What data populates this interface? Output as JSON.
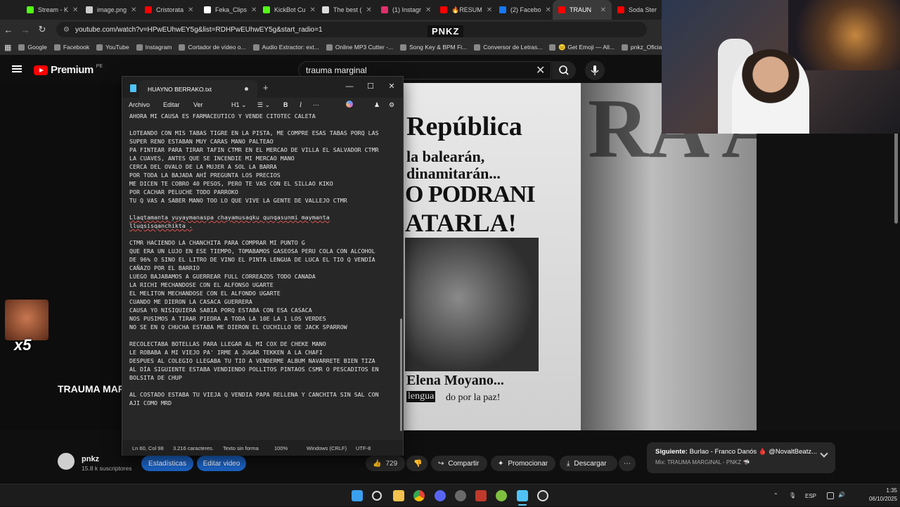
{
  "browser": {
    "tabs": [
      {
        "label": "Stream - K",
        "color": "#53fc18"
      },
      {
        "label": "image.png",
        "color": "#cccccc"
      },
      {
        "label": "Cristorata",
        "color": "#ff0000"
      },
      {
        "label": "Feka_Clips",
        "color": "#ffffff"
      },
      {
        "label": "KickBot Cu",
        "color": "#53fc18"
      },
      {
        "label": "The best (",
        "color": "#dddddd"
      },
      {
        "label": "(1) Instagr",
        "color": "#e1306c"
      },
      {
        "label": "🔥RESUM",
        "color": "#ff0000"
      },
      {
        "label": "(2) Facebo",
        "color": "#1877f2"
      },
      {
        "label": "TRAUN",
        "color": "#ff0000"
      },
      {
        "label": "Soda Ster",
        "color": "#ff0000"
      }
    ],
    "url": "youtube.com/watch?v=HPwEUhwEY5g&list=RDHPwEUhwEY5g&start_radio=1",
    "overlay_logo": "PNKZ",
    "bookmarks": [
      "Google",
      "Facebook",
      "YouTube",
      "Instagram",
      "Cortador de vídeo o...",
      "Audio Extractor: ext...",
      "Online MP3 Cutter -...",
      "Song Key & BPM Fi...",
      "Conversor de Letras...",
      "😐 Get Emoji — All...",
      "pnkz_Oficial"
    ]
  },
  "youtube": {
    "logo_word": "Premium",
    "logo_region": "PE",
    "search_value": "trauma marginal",
    "video_title": "TRAUMA MARG",
    "channel_name": "pnkz",
    "channel_subs": "15.8 k suscriptores",
    "buttons": {
      "stats": "Estadísticas",
      "edit": "Editar video",
      "likes": "729",
      "share": "Compartir",
      "promote": "Promocionar",
      "download": "Descargar"
    },
    "next": {
      "label": "Siguiente:",
      "title": "Burlao - Franco Danós 🩸 @NovaltBeatz...",
      "mix": "Mix: TRAUMA MARGINAL - PNKZ 🦈"
    },
    "newspaper": {
      "title": "República",
      "line1": "la balearán,",
      "line2": "dinamitarán...",
      "head1": "O PODRANI",
      "head2": "ATARLA!",
      "name": "Elena Moyano...",
      "sub": "lengua",
      "paz": "do por la paz!"
    },
    "blur_text": "RA A!",
    "emoji_count": "x5"
  },
  "notepad": {
    "filename": "HUAYNO BERRAKO.txt",
    "menus": {
      "archivo": "Archivo",
      "editar": "Editar",
      "ver": "Ver",
      "heading": "H1"
    },
    "lines": [
      "AHORA MI CAUSA ES FARMACEUTICO Y VENDE CITOTEC CALETA",
      "",
      "LOTEANDO CON MIS TABAS TIGRE EN LA PISTA, ME COMPRE ESAS TABAS PORQ LAS",
      "SUPER RENO ESTABAN MUY CARAS MANO PALTEAO",
      "PA FINTEAR PARA TIRAR TAFIN CTMR EN EL MERCAO DE VILLA EL SALVADOR CTMR",
      "LA CUAVES, ANTES QUE SE INCENDIE MI MERCAO MANO",
      "CERCA DEL OVALO DE LA MUJER A SOL LA BARRA",
      "POR TODA LA BAJADA AHÍ PREGUNTA LOS PRECIOS",
      "ME DICEN TE COBRO 40 PESOS, PERO TE VAS CON EL SILLAO KIKO",
      "POR CACHAR PELUCHE TODO PARROKO",
      "TU Q VAS A SABER MANO TOO LO QUE VIVE LA GENTE DE VALLEJO CTMR",
      "",
      "Llaqtamanta yuyaymanaspa chayamusaqku qunqasunmi maymanta",
      "lluqsisqanchikta .",
      "",
      "CTMR HACIENDO LA CHANCHITA PARA COMPRAR MI PUNTO G",
      "QUE ERA UN LUJO EN ESE TIEMPO, TOMABAMOS GASEOSA PERU COLA CON ALCOHOL",
      "DE 96% O SINO EL LITRO DE VINO EL PINTA LENGUA DE LUCA EL TIO Q VENDÍA",
      "CAÑAZO POR EL BARRIO",
      "LUEGO BAJABAMOS A GUERREAR FULL CORREAZOS TODO CANADA",
      "LA RICHI MECHANDOSE CON EL ALFONSO UGARTE",
      "EL MELITON MECHANDOSE CON EL ALFONDO UGARTE",
      "CUANDO ME DIERON LA CASACA GUERRERA",
      "CAUSA YO NISIQUIERA SABIA PORQ ESTABA CON ESA CASACA",
      "NOS PUSIMOS A TIRAR PIEDRA A TODA LA 10E LA 1 LOS VERDES",
      "NO SE EN Q CHUCHA ESTABA ME DIERON EL CUCHILLO DE JACK SPARROW",
      "",
      "RECOLECTABA BOTELLAS PARA LLEGAR AL MI COX DE CHEKE MANO",
      "LE ROBABA A MI VIEJO PA' IRME A JUGAR TEKKEN A LA CHAFI",
      "DESPUES AL COLEGIO LLEGABA TU TIO A VENDERME ALBUM NAVARRETE BIEN TIZA",
      "AL DÍA SIGUIENTE ESTABA VENDIENDO POLLITOS PINTAOS CSMR O PESCADITOS EN",
      "BOLSITA DE CHUP",
      "",
      "AL COSTADO ESTABA TU VIEJA Q VENDIA PAPA RELLENA Y CANCHITA SIN SAL CON",
      "AJI COMO MRD"
    ],
    "status": {
      "position": "Ln 60, Col 98",
      "chars": "3.216 caracteres.",
      "format": "Texto sin forma",
      "zoom": "100%",
      "eol": "Windows (CRLF)",
      "encoding": "UTF-8"
    }
  },
  "taskbar": {
    "lang": "ESP",
    "time": "1:35",
    "date": "06/10/2025"
  }
}
